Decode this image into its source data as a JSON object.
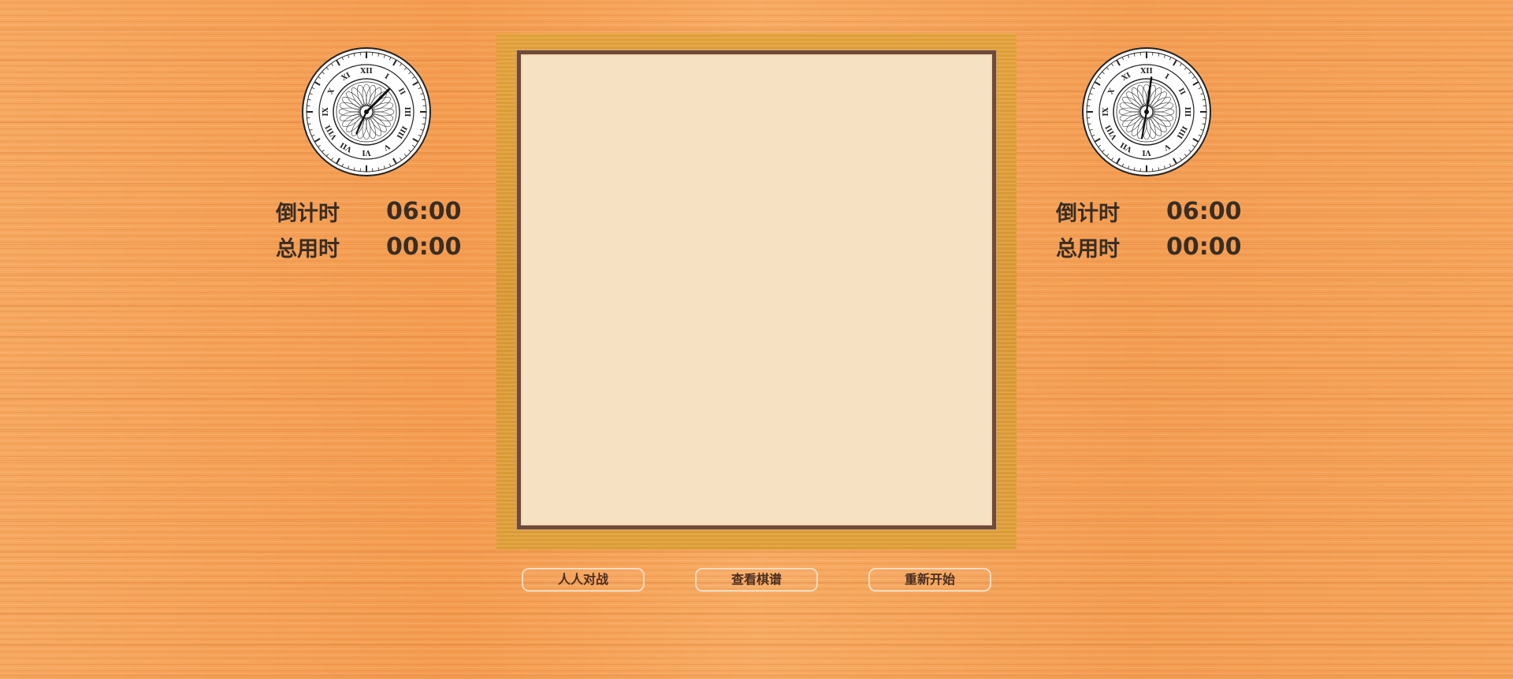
{
  "players": {
    "left": {
      "countdown_label": "倒计时",
      "countdown_value": "06:00",
      "total_label": "总用时",
      "total_value": "00:00",
      "icon": "clock-icon"
    },
    "right": {
      "countdown_label": "倒计时",
      "countdown_value": "06:00",
      "total_label": "总用时",
      "total_value": "00:00",
      "icon": "clock-icon"
    }
  },
  "buttons": {
    "pvp_label": "人人对战",
    "record_label": "查看棋谱",
    "restart_label": "重新开始"
  },
  "colors": {
    "background": "#f4a25a",
    "board_frame": "#e09e38",
    "board_surface": "#f7e1c3",
    "board_border": "#6e4a3a",
    "text": "#3a2d22",
    "button_border": "#f7dcc0"
  }
}
